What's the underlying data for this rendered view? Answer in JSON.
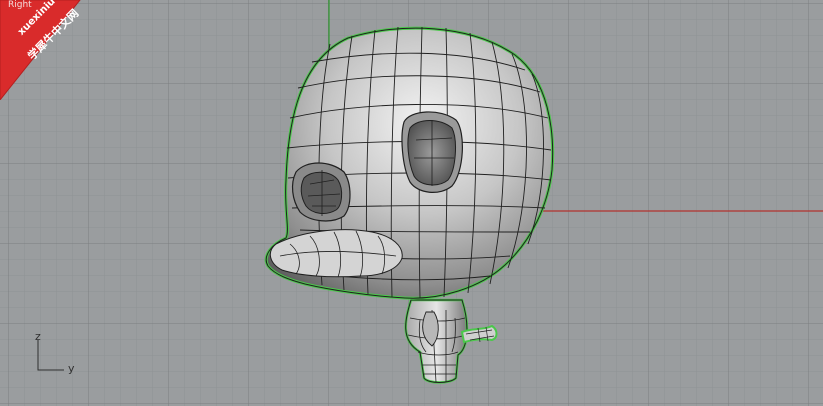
{
  "viewport": {
    "title": "Right",
    "axis_z": "z",
    "axis_y": "y"
  },
  "watermark": {
    "latin": "xuexiniu",
    "chinese": "学犀牛中文网"
  },
  "colors": {
    "background": "#9a9d9f",
    "grid_minor": "#8f9294",
    "grid_major": "#7c7f81",
    "x_axis_red": "#b2322f",
    "z_axis_green": "#2f9b2f",
    "selection_outline": "#4bc84b",
    "model_fill": "#c8c8c8",
    "wireframe": "#202020",
    "watermark_red": "#d92b2b"
  }
}
